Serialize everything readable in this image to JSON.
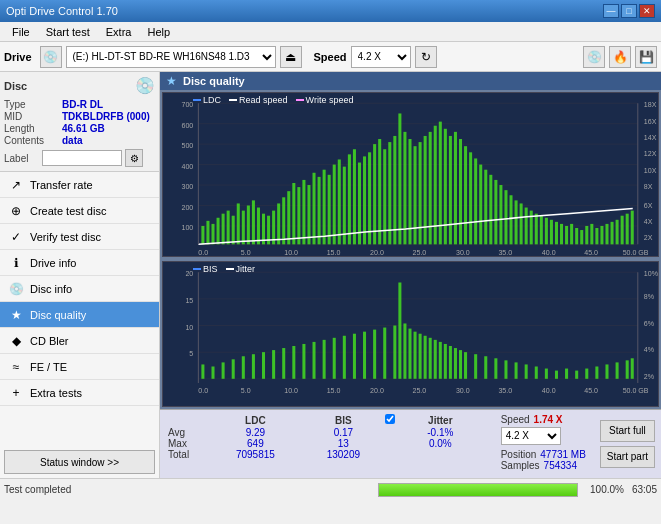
{
  "window": {
    "title": "Opti Drive Control 1.70",
    "controls": [
      "—",
      "□",
      "✕"
    ]
  },
  "menu": {
    "items": [
      "File",
      "Start test",
      "Extra",
      "Help"
    ]
  },
  "toolbar": {
    "drive_label": "Drive",
    "drive_value": "(E:) HL-DT-ST BD-RE  WH16NS48 1.D3",
    "speed_label": "Speed",
    "speed_value": "4.2 X"
  },
  "disc": {
    "title": "Disc",
    "type_label": "Type",
    "type_value": "BD-R DL",
    "mid_label": "MID",
    "mid_value": "TDKBLDRFB (000)",
    "length_label": "Length",
    "length_value": "46.61 GB",
    "contents_label": "Contents",
    "contents_value": "data",
    "label_label": "Label"
  },
  "nav": {
    "items": [
      {
        "id": "transfer-rate",
        "label": "Transfer rate",
        "icon": "↗"
      },
      {
        "id": "create-test-disc",
        "label": "Create test disc",
        "icon": "⊕"
      },
      {
        "id": "verify-test-disc",
        "label": "Verify test disc",
        "icon": "✓"
      },
      {
        "id": "drive-info",
        "label": "Drive info",
        "icon": "ℹ"
      },
      {
        "id": "disc-info",
        "label": "Disc info",
        "icon": "💿"
      },
      {
        "id": "disc-quality",
        "label": "Disc quality",
        "icon": "★",
        "active": true
      },
      {
        "id": "cd-bler",
        "label": "CD Bler",
        "icon": "◆"
      },
      {
        "id": "fe-te",
        "label": "FE / TE",
        "icon": "≈"
      },
      {
        "id": "extra-tests",
        "label": "Extra tests",
        "icon": "+"
      }
    ],
    "status_btn": "Status window >>"
  },
  "content": {
    "title": "Disc quality",
    "chart1": {
      "legend": [
        "LDC",
        "Read speed",
        "Write speed"
      ],
      "y_max": 700,
      "y_axis_right": [
        "18X",
        "16X",
        "14X",
        "12X",
        "10X",
        "8X",
        "6X",
        "4X",
        "2X"
      ],
      "x_max": 50
    },
    "chart2": {
      "legend": [
        "BIS",
        "Jitter"
      ],
      "y_max": 20,
      "y_axis_right": [
        "10%",
        "8%",
        "6%",
        "4%",
        "2%"
      ],
      "x_max": 50
    }
  },
  "stats": {
    "col_ldc": "LDC",
    "col_bis": "BIS",
    "col_jitter": "Jitter",
    "row_avg": "Avg",
    "row_max": "Max",
    "row_total": "Total",
    "ldc_avg": "9.29",
    "ldc_max": "649",
    "ldc_total": "7095815",
    "bis_avg": "0.17",
    "bis_max": "13",
    "bis_total": "130209",
    "jitter_avg": "-0.1%",
    "jitter_max": "0.0%",
    "jitter_total": "",
    "jitter_label": "Jitter",
    "speed_label": "Speed",
    "speed_value": "1.74 X",
    "speed_select": "4.2 X",
    "position_label": "Position",
    "position_value": "47731 MB",
    "samples_label": "Samples",
    "samples_value": "754334",
    "btn_start_full": "Start full",
    "btn_start_part": "Start part"
  },
  "statusbar": {
    "text": "Test completed",
    "progress": 100,
    "progress_text": "100.0%",
    "time": "63:05"
  }
}
